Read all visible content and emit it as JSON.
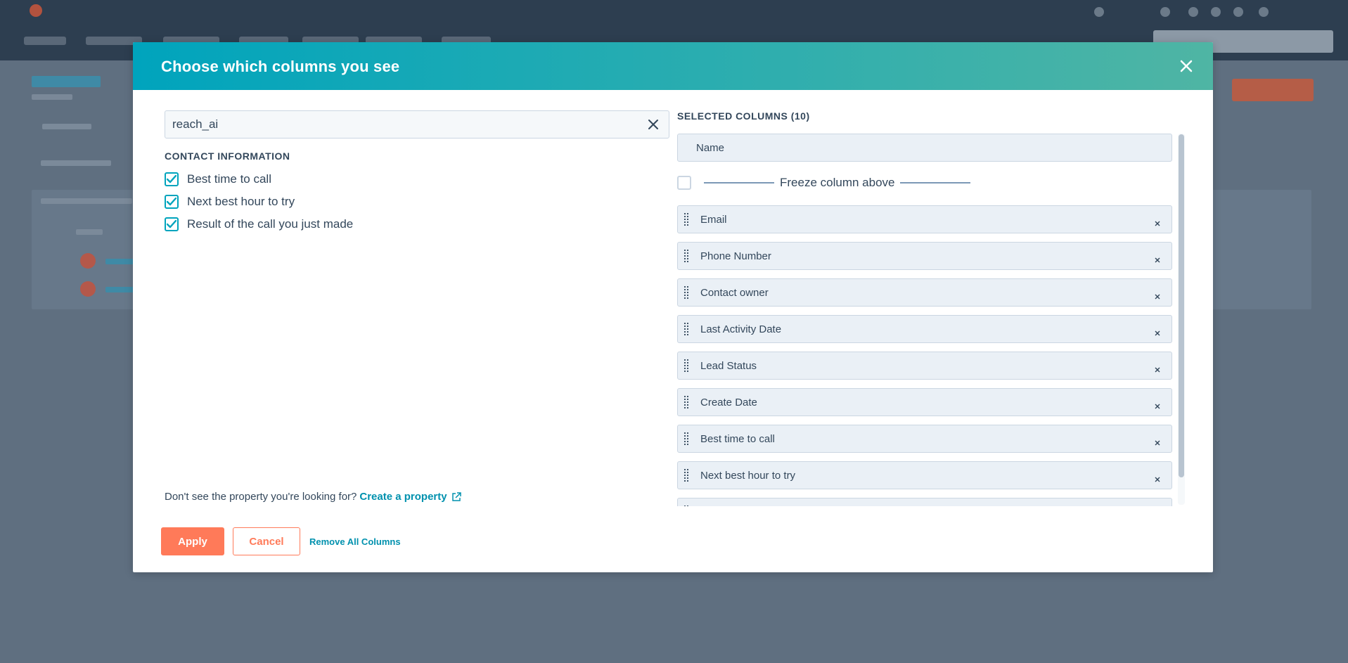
{
  "modal": {
    "title": "Choose which columns you see"
  },
  "search": {
    "value": "reach_ai"
  },
  "results": {
    "section_heading": "CONTACT INFORMATION",
    "items": [
      {
        "label": "Best time to call",
        "checked": true
      },
      {
        "label": "Next best hour to try",
        "checked": true
      },
      {
        "label": "Result of the call you just made",
        "checked": true
      }
    ]
  },
  "selected": {
    "heading": "SELECTED COLUMNS (10)",
    "fixed_column": "Name",
    "freeze_label": "Freeze column above",
    "columns": [
      "Email",
      "Phone Number",
      "Contact owner",
      "Last Activity Date",
      "Lead Status",
      "Create Date",
      "Best time to call",
      "Next best hour to try"
    ]
  },
  "footer": {
    "hint": "Don't see the property you're looking for?",
    "create_link": "Create a property",
    "apply_label": "Apply",
    "cancel_label": "Cancel",
    "remove_all_label": "Remove All Columns"
  },
  "colors": {
    "header_start": "#00a4bd",
    "header_end": "#4fb5a4",
    "primary_button": "#ff7a59",
    "link": "#0091ae",
    "overlay": "#5f6f80"
  }
}
